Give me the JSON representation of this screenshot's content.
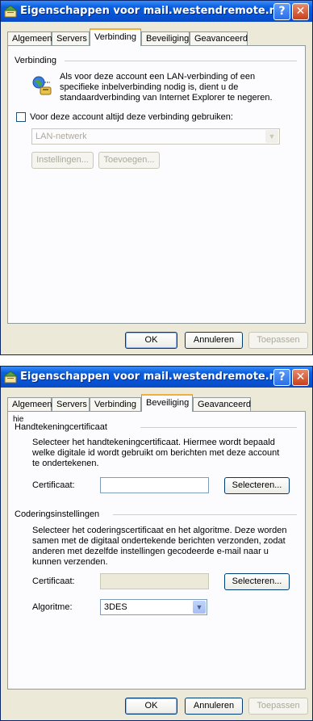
{
  "window1": {
    "title": "Eigenschappen voor mail.westendremote.nl",
    "help_label": "?",
    "close_label": "✕",
    "tabs": [
      "Algemeen",
      "Servers",
      "Verbinding",
      "Beveiliging",
      "Geavanceerd"
    ],
    "active_tab": "Verbinding",
    "connection": {
      "group_title": "Verbinding",
      "description_lines": [
        "Als voor deze account een LAN-verbinding of een",
        "specifieke inbelverbinding nodig is, dient u de",
        "standaardverbinding van Internet Explorer te negeren."
      ],
      "checkbox_label": "Voor deze account altijd deze verbinding gebruiken:",
      "checkbox_checked": false,
      "dropdown_value": "LAN-netwerk",
      "settings_button": "Instellingen...",
      "add_button": "Toevoegen..."
    },
    "buttons": {
      "ok": "OK",
      "cancel": "Annuleren",
      "apply": "Toepassen"
    }
  },
  "window2": {
    "title": "Eigenschappen voor mail.westendremote.nl",
    "help_label": "?",
    "close_label": "✕",
    "tabs": [
      "Algemeen",
      "Servers",
      "Verbinding",
      "Beveiliging",
      "Geavanceerd"
    ],
    "active_tab": "Beveiliging",
    "stray_text": "hie",
    "signing": {
      "group_title": "Handtekeningcertificaat",
      "description_lines": [
        "Selecteer het handtekeningcertificaat. Hiermee wordt bepaald",
        "welke digitale id wordt gebruikt om berichten met deze account",
        "te ondertekenen."
      ],
      "certificate_label": "Certificaat:",
      "certificate_value": "",
      "select_button": "Selecteren..."
    },
    "encryption": {
      "group_title": "Coderingsinstellingen",
      "description_lines": [
        "Selecteer het coderingscertificaat en het algoritme. Deze worden",
        "samen met de digitaal ondertekende berichten verzonden, zodat",
        "anderen met dezelfde instellingen gecodeerde e-mail naar u",
        "kunnen verzenden."
      ],
      "certificate_label": "Certificaat:",
      "certificate_value": "",
      "select_button": "Selecteren...",
      "algorithm_label": "Algoritme:",
      "algorithm_value": "3DES"
    },
    "buttons": {
      "ok": "OK",
      "cancel": "Annuleren",
      "apply": "Toepassen"
    }
  },
  "colors": {
    "titlebar": "#0653d6",
    "dialog_bg": "#ece9d8",
    "active_tab_accent": "#f0b13a"
  }
}
